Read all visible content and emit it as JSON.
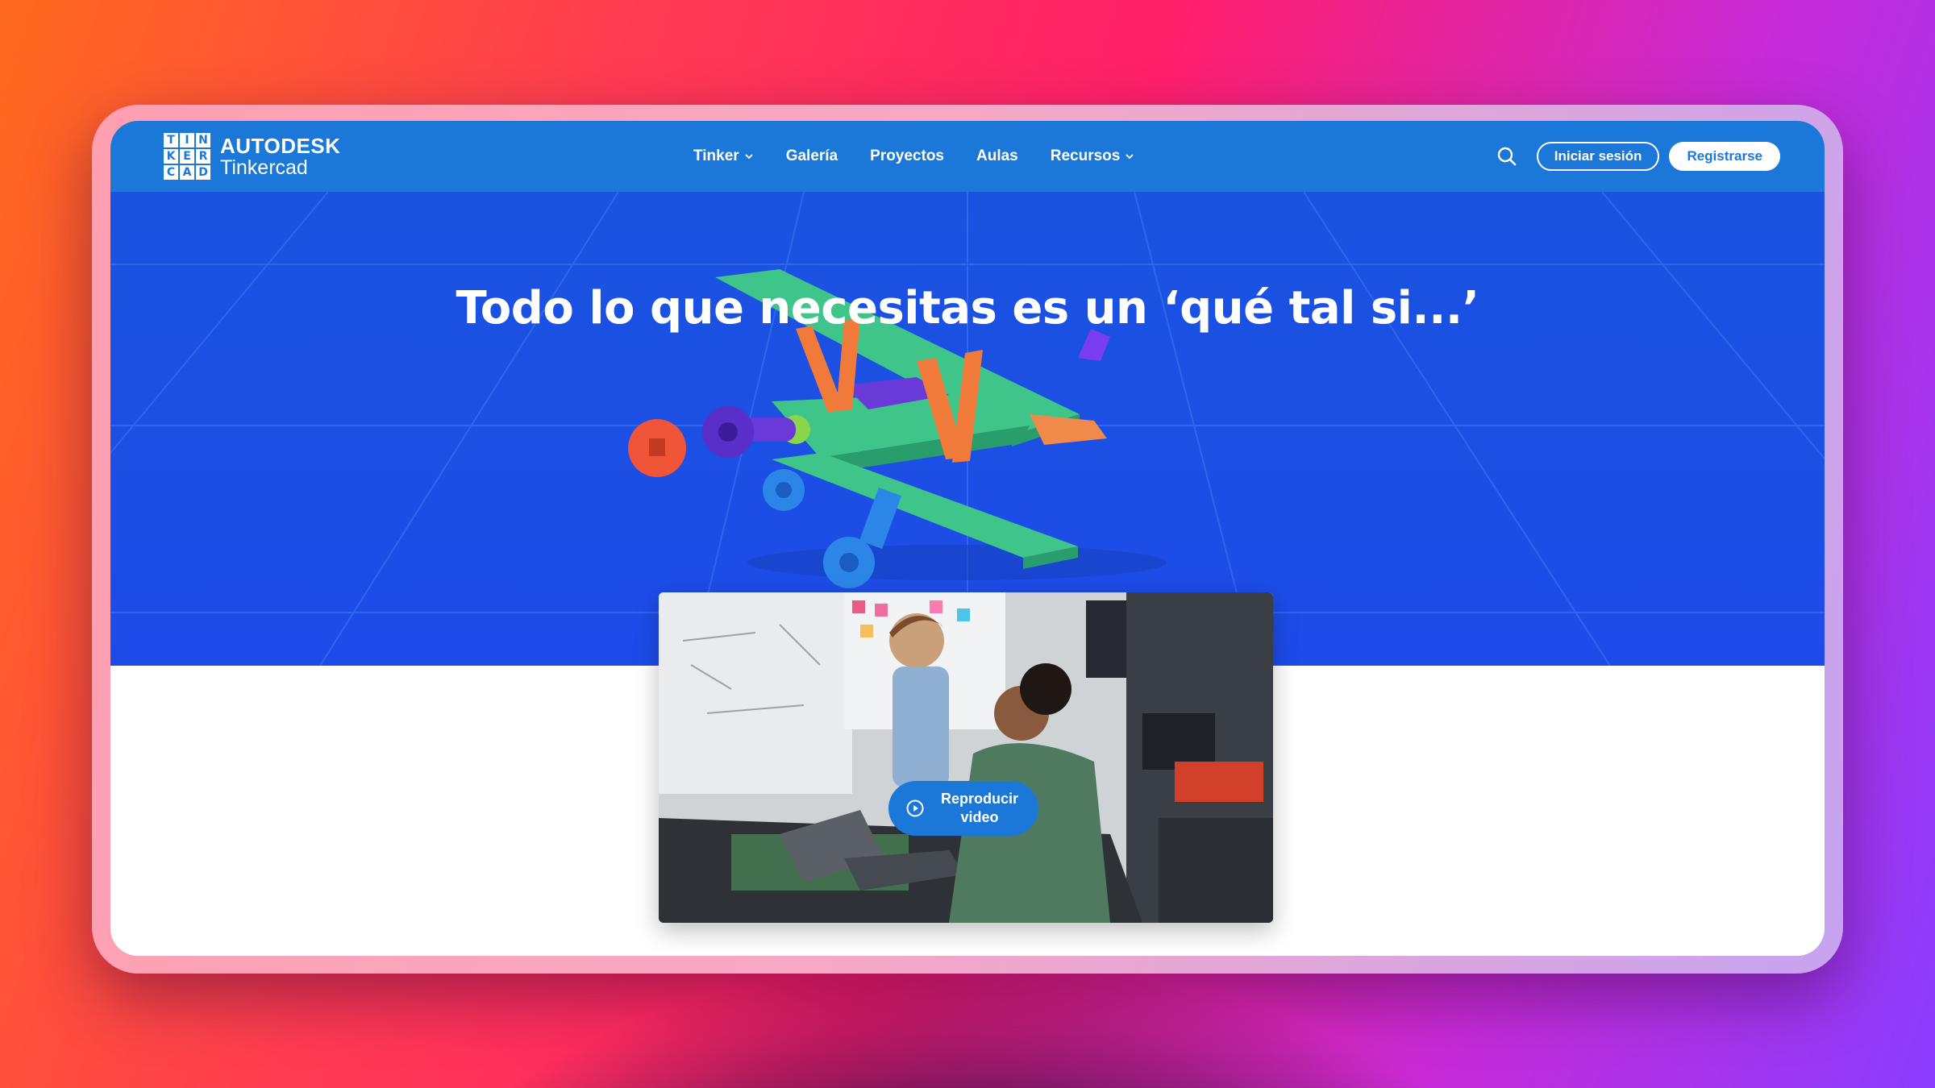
{
  "nav": {
    "logo_letters": [
      "T",
      "I",
      "N",
      "K",
      "E",
      "R",
      "C",
      "A",
      "D"
    ],
    "brand": "AUTODESK",
    "product": "Tinkercad",
    "items": [
      {
        "label": "Tinker",
        "has_dropdown": true
      },
      {
        "label": "Galería",
        "has_dropdown": false
      },
      {
        "label": "Proyectos",
        "has_dropdown": false
      },
      {
        "label": "Aulas",
        "has_dropdown": false
      },
      {
        "label": "Recursos",
        "has_dropdown": true
      }
    ],
    "search_icon": "search-icon",
    "login_label": "Iniciar sesión",
    "signup_label": "Registrarse"
  },
  "hero": {
    "title": "Todo lo que necesitas es un ‘qué tal si...’"
  },
  "video": {
    "play_label": "Reproducir video",
    "play_icon": "play-circle-icon"
  },
  "colors": {
    "nav_blue": "#1b78d8",
    "hero_blue": "#1c4fe4",
    "button_text": "#1b78d8"
  }
}
